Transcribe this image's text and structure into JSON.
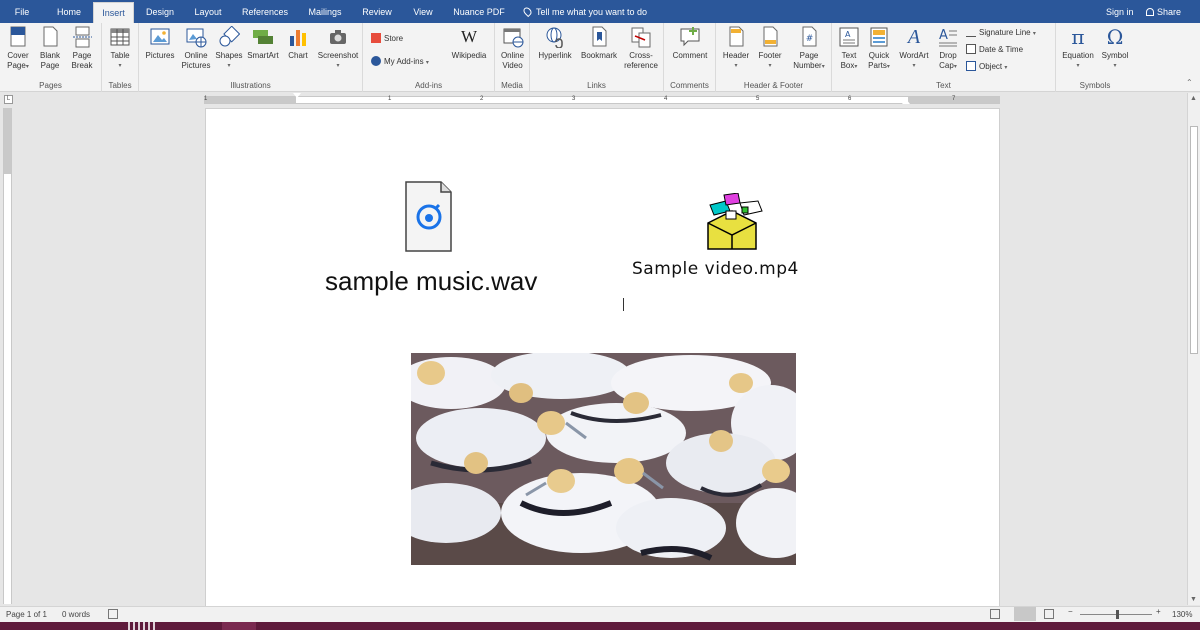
{
  "tabs": [
    "File",
    "Home",
    "Insert",
    "Design",
    "Layout",
    "References",
    "Mailings",
    "Review",
    "View",
    "Nuance PDF"
  ],
  "active_tab": "Insert",
  "tell_me": "Tell me what you want to do",
  "sign_in": "Sign in",
  "share": "Share",
  "ribbon": {
    "pages": {
      "label": "Pages",
      "cover": "Cover",
      "cover2": "Page",
      "blank": "Blank",
      "blank2": "Page",
      "break": "Page",
      "break2": "Break"
    },
    "tables": {
      "label": "Tables",
      "table": "Table"
    },
    "illustrations": {
      "label": "Illustrations",
      "pictures": "Pictures",
      "online": "Online",
      "online2": "Pictures",
      "shapes": "Shapes",
      "smartart": "SmartArt",
      "chart": "Chart",
      "screenshot": "Screenshot"
    },
    "addins": {
      "label": "Add-ins",
      "store": "Store",
      "myaddins": "My Add-ins",
      "wikipedia": "Wikipedia"
    },
    "media": {
      "label": "Media",
      "online": "Online",
      "video": "Video"
    },
    "links": {
      "label": "Links",
      "hyperlink": "Hyperlink",
      "bookmark": "Bookmark",
      "cross": "Cross-",
      "reference": "reference"
    },
    "comments": {
      "label": "Comments",
      "comment": "Comment"
    },
    "hf": {
      "label": "Header & Footer",
      "header": "Header",
      "footer": "Footer",
      "pagenum": "Page",
      "pagenum2": "Number"
    },
    "text": {
      "label": "Text",
      "textbox": "Text",
      "textbox2": "Box",
      "quick": "Quick",
      "quick2": "Parts",
      "wordart": "WordArt",
      "drop": "Drop",
      "drop2": "Cap",
      "signature": "Signature Line",
      "datetime": "Date & Time",
      "object": "Object"
    },
    "symbols": {
      "label": "Symbols",
      "equation": "Equation",
      "symbol": "Symbol"
    }
  },
  "ruler_numbers": [
    "1",
    "1",
    "2",
    "3",
    "4",
    "5",
    "6",
    "7"
  ],
  "document": {
    "audio_caption": "sample music.wav",
    "video_caption": "Sample video.mp4"
  },
  "status": {
    "page": "Page 1 of 1",
    "words": "0 words",
    "zoom": "130%"
  },
  "colors": {
    "accent": "#2b579a",
    "taskbar": "#5e1a3b"
  }
}
